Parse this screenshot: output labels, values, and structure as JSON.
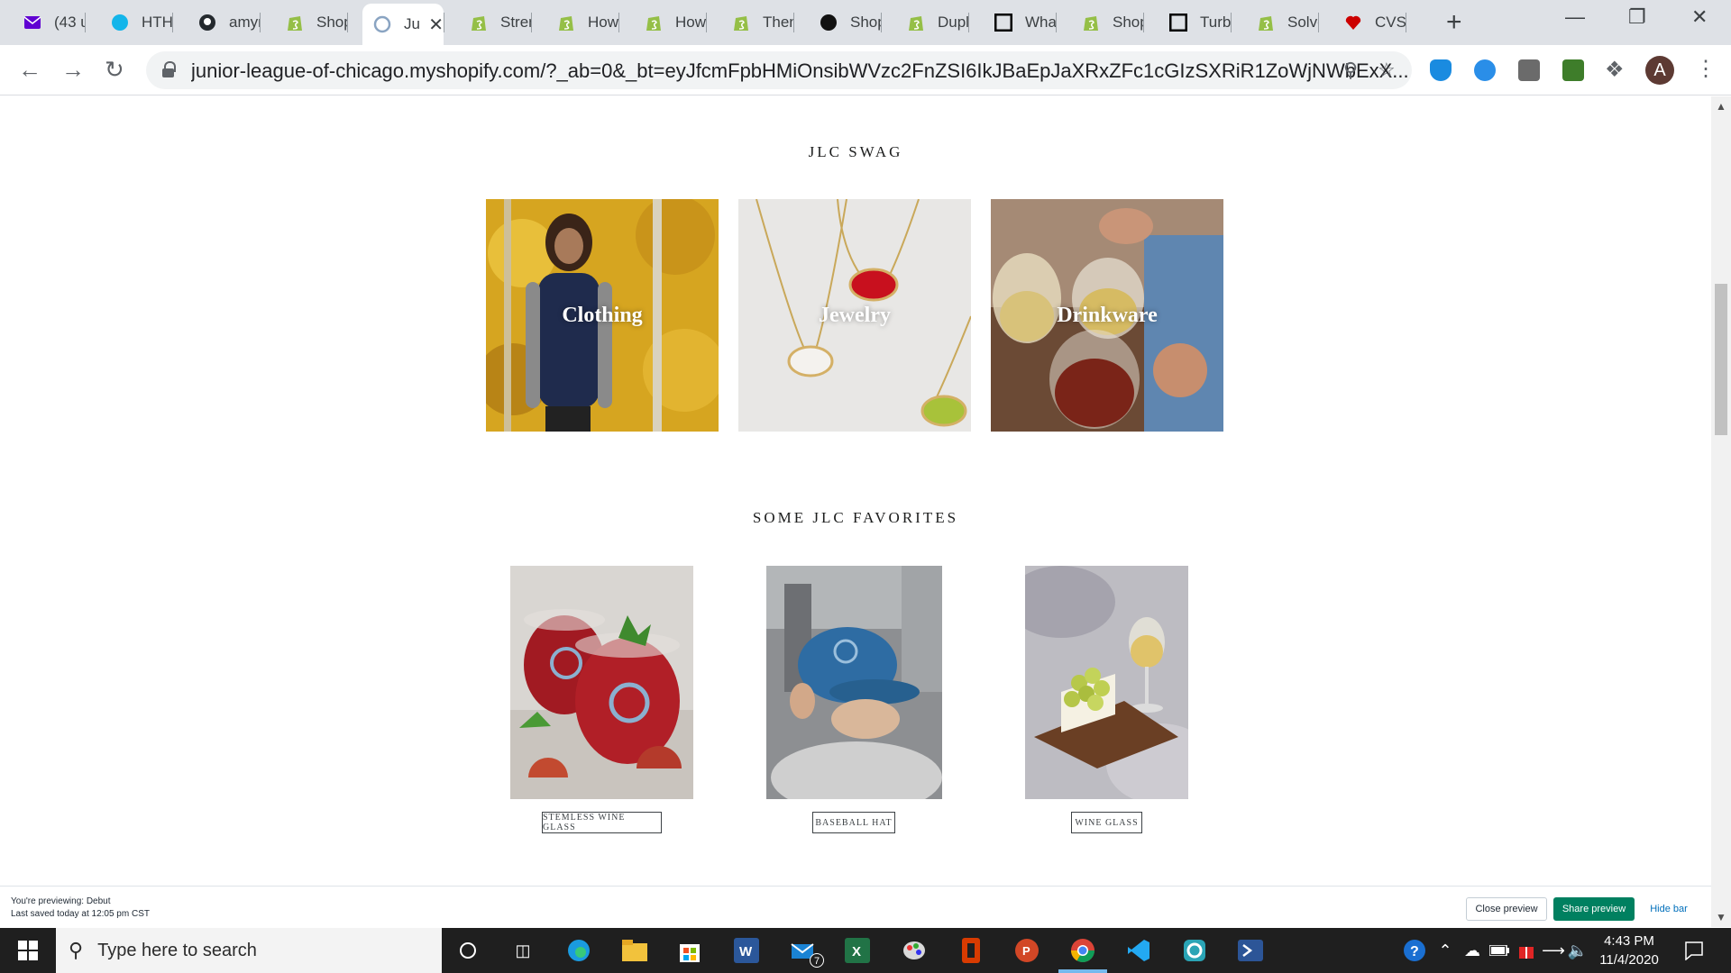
{
  "browser": {
    "tabs": [
      {
        "label": "(43 u",
        "icon": "yahoo-mail-icon",
        "color": "#6001d2"
      },
      {
        "label": "HTH,",
        "icon": "xero-icon",
        "color": "#13b5ea"
      },
      {
        "label": "amyn",
        "icon": "github-icon",
        "color": "#24292e"
      },
      {
        "label": "Shop",
        "icon": "shopify-icon",
        "color": "#95bf47"
      },
      {
        "label": "Ju",
        "icon": "jlc-icon",
        "color": "#8aa4c2"
      },
      {
        "label": "Stren",
        "icon": "shopify-icon",
        "color": "#95bf47"
      },
      {
        "label": "How",
        "icon": "shopify-icon",
        "color": "#95bf47"
      },
      {
        "label": "How",
        "icon": "shopify-icon",
        "color": "#95bf47"
      },
      {
        "label": "Then",
        "icon": "shopify-icon",
        "color": "#95bf47"
      },
      {
        "label": "Shop",
        "icon": "sk-icon",
        "color": "#111111"
      },
      {
        "label": "Dupli",
        "icon": "shopify-icon",
        "color": "#95bf47"
      },
      {
        "label": "What",
        "icon": "square-icon",
        "color": "#000000"
      },
      {
        "label": "Shop",
        "icon": "shopify-icon",
        "color": "#95bf47"
      },
      {
        "label": "Turbo",
        "icon": "square-icon",
        "color": "#000000"
      },
      {
        "label": "Solve",
        "icon": "shopify-icon",
        "color": "#95bf47"
      },
      {
        "label": "CVS |",
        "icon": "heart-icon",
        "color": "#cc0000"
      }
    ],
    "active_tab_index": 4,
    "url": "junior-league-of-chicago.myshopify.com/?_ab=0&_bt=eyJfcmFpbHMiOnsibWVzc2FnZSI6IkJBaEpJaXRxZFc1cGIzSXRiR1ZoWjNWbExX...",
    "profile_initial": "A"
  },
  "page": {
    "swag_title": "JLC SWAG",
    "collections": [
      {
        "label": "Clothing"
      },
      {
        "label": "Jewelry"
      },
      {
        "label": "Drinkware"
      }
    ],
    "favorites_title": "SOME JLC FAVORITES",
    "products": [
      {
        "label": "STEMLESS WINE GLASS"
      },
      {
        "label": "BASEBALL HAT"
      },
      {
        "label": "WINE GLASS"
      }
    ]
  },
  "preview_bar": {
    "previewing": "You're previewing: Debut",
    "last_saved": "Last saved today at 12:05 pm CST",
    "close_label": "Close preview",
    "share_label": "Share preview",
    "hide_label": "Hide bar",
    "share_color": "#008060"
  },
  "taskbar": {
    "search_placeholder": "Type here to search",
    "time": "4:43 PM",
    "date": "11/4/2020",
    "mail_badge": "7"
  }
}
